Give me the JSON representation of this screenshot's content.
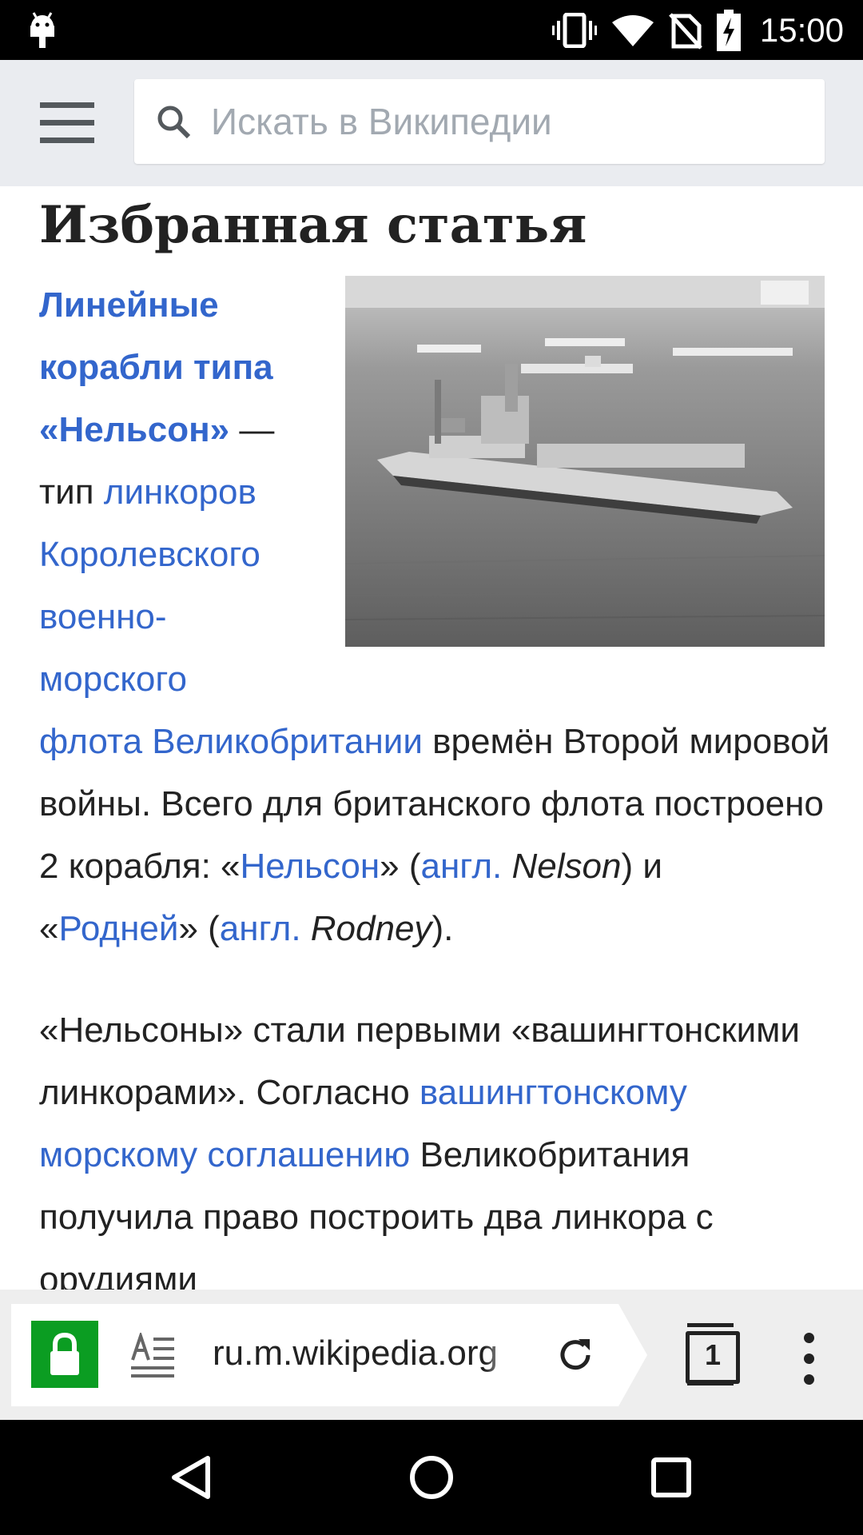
{
  "status_bar": {
    "time": "15:00",
    "icons": [
      "android-notification-icon",
      "vibrate-icon",
      "wifi-icon",
      "no-sim-icon",
      "battery-charging-icon"
    ]
  },
  "header": {
    "search_placeholder": "Искать в Википедии"
  },
  "article": {
    "section_title": "Избранная статья",
    "image_alt": "",
    "p1": {
      "lead": [
        "Линейные",
        "корабли типа",
        "«Нельсон»"
      ],
      "dash": " —",
      "t_type": "тип ",
      "link_linkors": "линкоров",
      "link_navy": [
        "Королевского",
        "военно-",
        "морского",
        "флота Великобритании"
      ],
      "t_wwii": " времён Второй мировой войны. Всего для британского флота построено 2 корабля: «",
      "link_nelson": "Нельсон",
      "t_close1": "» (",
      "link_engl1": "англ.",
      "nelson_en": " Nelson",
      "t_and": ") и «",
      "link_rodney": "Родней",
      "t_close2": "» (",
      "link_engl2": "англ.",
      "rodney_en": " Rodney",
      "t_end": ")."
    },
    "p2": {
      "t1": "«Нельсоны» стали первыми «вашингтонскими линкорами». Согласно ",
      "link_treaty": "вашингтонскому морскому соглашению",
      "t2": " Великобритания получила право построить два линкора с орудиями"
    }
  },
  "browser": {
    "url": "ru.m.wikipedia.org",
    "tab_count": "1",
    "icons": [
      "lock-icon",
      "reader-mode-icon",
      "reload-icon",
      "tab-switcher-icon",
      "overflow-menu-icon"
    ]
  },
  "nav_bar": {
    "icons": [
      "back-icon",
      "home-icon",
      "recents-icon"
    ]
  }
}
